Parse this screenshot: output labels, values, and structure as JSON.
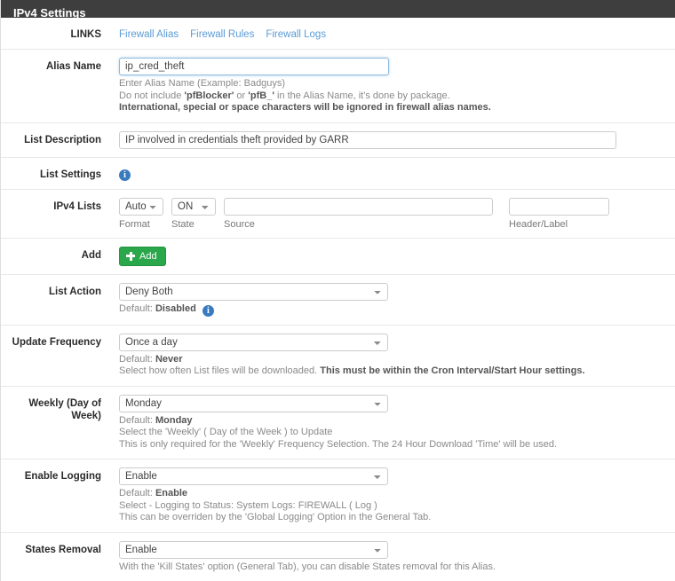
{
  "panel": {
    "title": "IPv4 Settings"
  },
  "rows": {
    "links": {
      "label": "LINKS",
      "items": [
        {
          "label": "Firewall Alias"
        },
        {
          "label": "Firewall Rules"
        },
        {
          "label": "Firewall Logs"
        }
      ]
    },
    "alias_name": {
      "label": "Alias Name",
      "value": "ip_cred_theft",
      "placeholder": "",
      "help_line1": "Enter Alias Name (Example: Badguys)",
      "help_line2_pre": "Do not include ",
      "help_line2_b1": "'pfBlocker'",
      "help_line2_mid": " or ",
      "help_line2_b2": "'pfB_'",
      "help_line2_post": " in the Alias Name, it's done by package.",
      "help_line3": "International, special or space characters will be ignored in firewall alias names."
    },
    "list_description": {
      "label": "List Description",
      "value": "IP involved in credentials theft provided by GARR",
      "placeholder": ""
    },
    "list_settings": {
      "label": "List Settings",
      "info_icon": "info-icon"
    },
    "ipv4_lists": {
      "label": "IPv4 Lists",
      "format": {
        "value": "Auto",
        "caption": "Format"
      },
      "state": {
        "value": "ON",
        "caption": "State"
      },
      "source": {
        "value": "",
        "placeholder": "",
        "caption": "Source"
      },
      "header": {
        "value": "",
        "placeholder": "",
        "caption": "Header/Label"
      }
    },
    "add": {
      "label": "Add",
      "button_label": "Add",
      "button_icon": "plus-icon"
    },
    "list_action": {
      "label": "List Action",
      "value": "Deny Both",
      "default_pre": "Default: ",
      "default_val": "Disabled",
      "info_icon": "info-icon"
    },
    "update_frequency": {
      "label": "Update Frequency",
      "value": "Once a day",
      "default_pre": "Default: ",
      "default_val": "Never",
      "help_pre": "Select how often List files will be downloaded. ",
      "help_strong": "This must be within the Cron Interval/Start Hour settings."
    },
    "weekly_day": {
      "label": "Weekly (Day of Week)",
      "value": "Monday",
      "default_pre": "Default: ",
      "default_val": "Monday",
      "help_line1": "Select the 'Weekly' ( Day of the Week ) to Update",
      "help_line2": "This is only required for the 'Weekly' Frequency Selection. The 24 Hour Download 'Time' will be used."
    },
    "enable_logging": {
      "label": "Enable Logging",
      "value": "Enable",
      "default_pre": "Default: ",
      "default_val": "Enable",
      "help_line1": "Select - Logging to Status: System Logs: FIREWALL ( Log )",
      "help_line2": "This can be overriden by the 'Global Logging' Option in the General Tab."
    },
    "states_removal": {
      "label": "States Removal",
      "value": "Enable",
      "help_line1": "With the 'Kill States' option (General Tab), you can disable States removal for this Alias."
    }
  },
  "colors": {
    "header_bg": "#3e3e3e",
    "link": "#5b9bd5",
    "info_blue": "#3a7bbf",
    "add_green": "#2aa64b",
    "row_border": "#e8e8e8"
  }
}
